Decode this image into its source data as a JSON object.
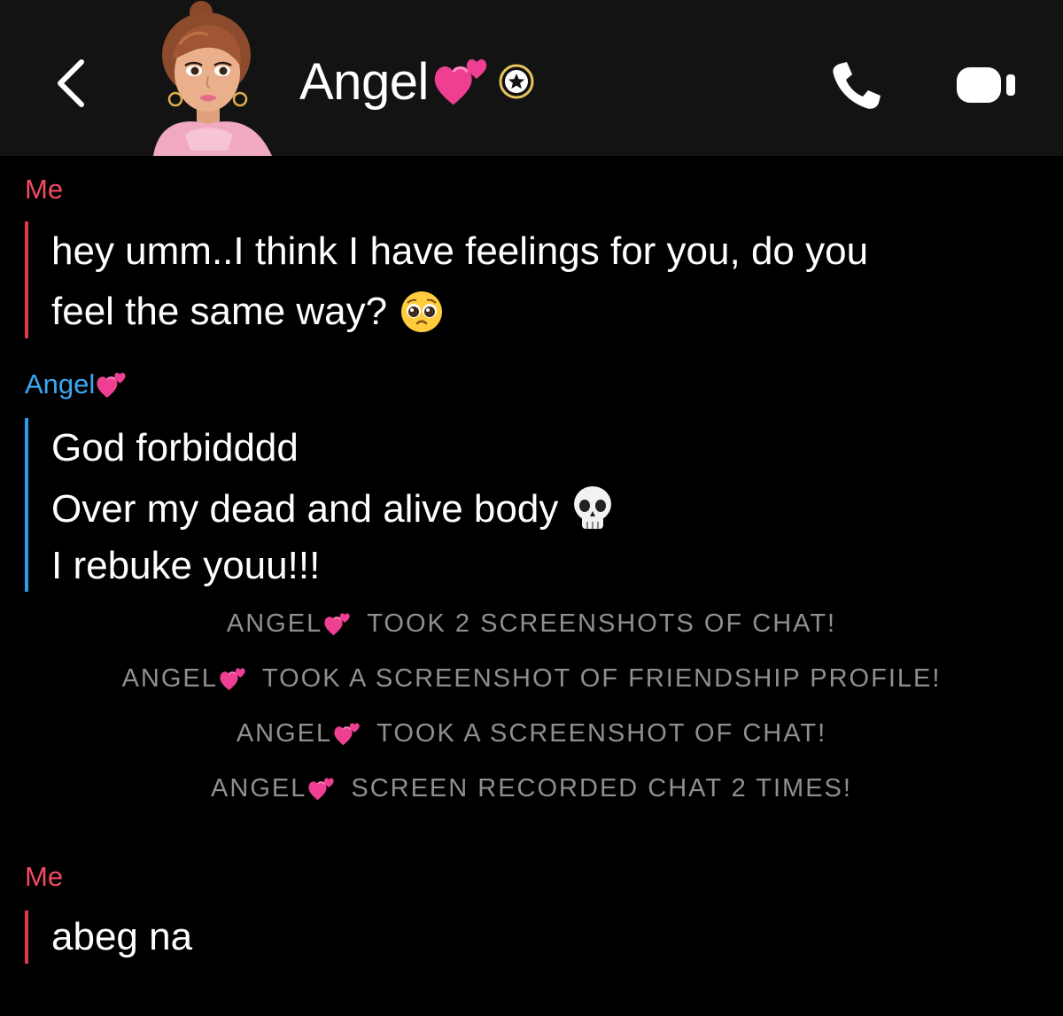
{
  "header": {
    "title": "Angel"
  },
  "messages": [
    {
      "sender": "Me",
      "lines": [
        "hey umm..I think I have feelings for you, do you",
        "feel the same way?"
      ]
    },
    {
      "sender": "Angel",
      "lines": [
        "God forbidddd",
        "Over my dead and alive body",
        "I rebuke youu!!!"
      ]
    },
    {
      "sender": "Me",
      "lines": [
        "abeg na"
      ]
    }
  ],
  "notices": [
    {
      "name": "ANGEL",
      "text": "TOOK 2 SCREENSHOTS OF CHAT!"
    },
    {
      "name": "ANGEL",
      "text": "TOOK A SCREENSHOT OF FRIENDSHIP PROFILE!"
    },
    {
      "name": "ANGEL",
      "text": "TOOK A SCREENSHOT OF CHAT!"
    },
    {
      "name": "ANGEL",
      "text": "SCREEN RECORDED CHAT 2 TIMES!"
    }
  ],
  "icons": {
    "back": "chevron-left-icon",
    "avatar": "bitmoji-avatar",
    "badge": "star-badge-icon",
    "call": "phone-icon",
    "video": "video-camera-icon",
    "heart": "two-hearts-emoji",
    "pleading": "pleading-face-emoji",
    "skull": "skull-emoji"
  },
  "colors": {
    "me": "#f14b63",
    "friend": "#3aa7f2",
    "notice": "#8f8f8f",
    "header_bg": "#131313",
    "background": "#000000"
  }
}
